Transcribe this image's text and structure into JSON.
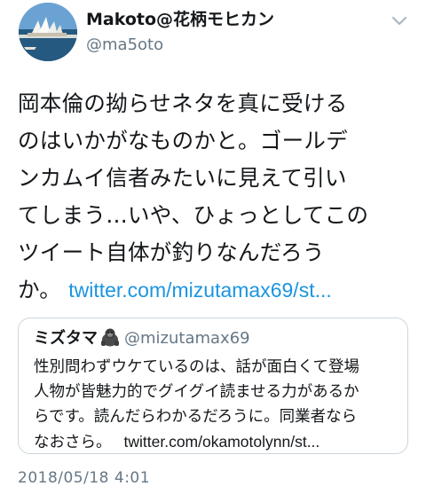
{
  "author": {
    "display_name": "Makoto@花柄モヒカン",
    "handle": "@ma5oto",
    "avatar_icon": "opera-house-photo-avatar"
  },
  "tweet": {
    "lines": [
      "岡本倫の拗らせネタを真に受ける",
      "のはいかがなものかと。ゴールデ",
      "ンカムイ信者みたいに見えて引い",
      "てしまう…いや、ひょっとしてこの",
      "ツイート自体が釣りなんだろう",
      "か。"
    ],
    "link": "twitter.com/mizutamax69/st..."
  },
  "quote": {
    "name": "ミズタマ",
    "emoji": "gorilla-icon",
    "handle": "@mizutamax69",
    "lines": [
      "性別問わずウケているのは、話が面白くて登場",
      "人物が皆魅力的でグイグイ読ませる力があるか",
      "らです。読んだらわかるだろうに。同業者なら",
      "なおさら。"
    ],
    "link": "twitter.com/okamotolynn/st..."
  },
  "timestamp": "2018/05/18 4:01",
  "colors": {
    "link": "#1b95e0",
    "secondary_text": "#657786",
    "border": "#ccd6dd"
  }
}
